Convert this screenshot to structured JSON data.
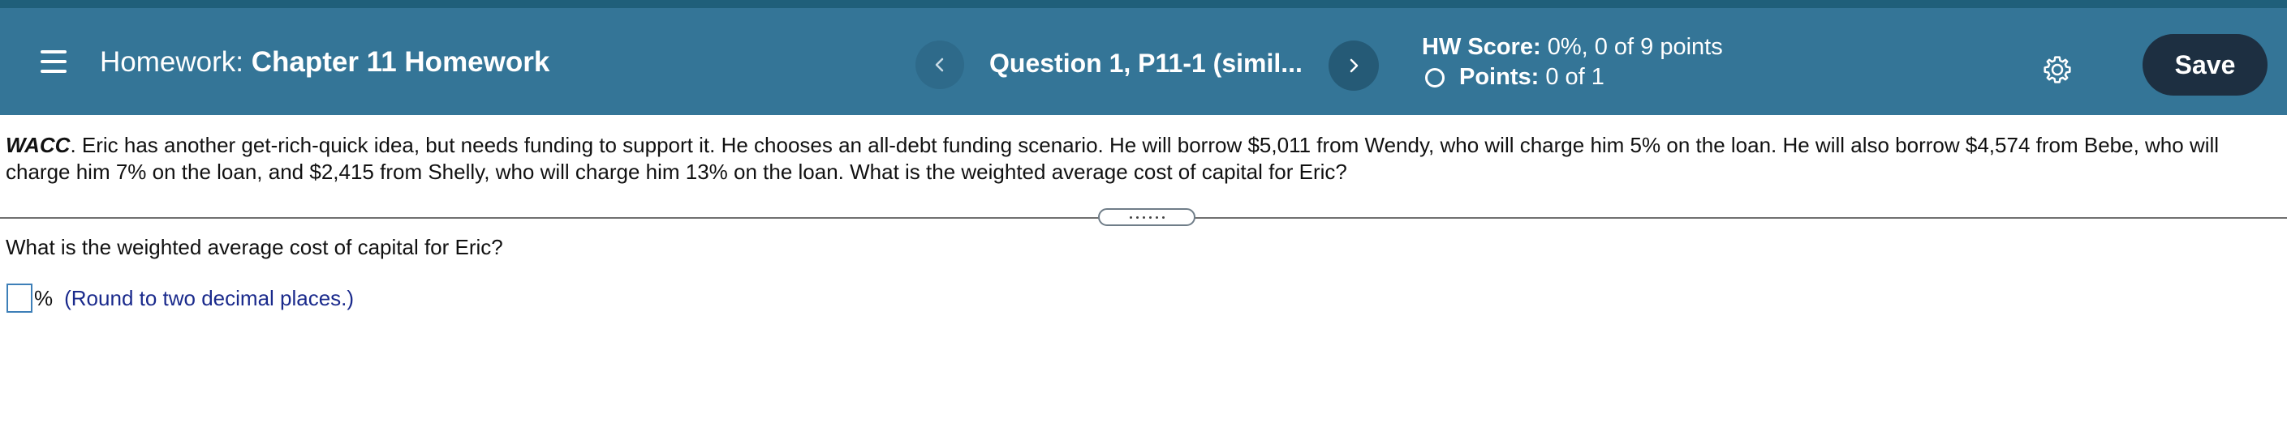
{
  "header": {
    "title_prefix": "Homework:",
    "title_name": "Chapter 11 Homework",
    "question_label": "Question 1, P11-1 (simil...",
    "hw_score_label": "HW Score:",
    "hw_score_value": "0%, 0 of 9 points",
    "points_label": "Points:",
    "points_value": "0 of 1",
    "save_label": "Save",
    "nav_prev_glyph": "‹",
    "nav_next_glyph": "›"
  },
  "problem": {
    "lead": "WACC",
    "text": ".  Eric has another get-rich-quick idea, but needs funding to support it.  He chooses an all-debt funding scenario.  He will borrow $5,011 from Wendy, who will charge him 5% on the loan.  He will also borrow $4,574 from Bebe, who will charge him 7% on the loan, and $2,415 from Shelly, who will charge him 13% on the loan.  What is the weighted average cost of capital for Eric?"
  },
  "question": {
    "prompt": "What is the weighted average cost of capital for Eric?",
    "answer_value": "",
    "unit": "%",
    "hint": "(Round to two decimal places.)"
  },
  "icons": {
    "menu": "hamburger-menu-icon",
    "prev": "chevron-left-icon",
    "next": "chevron-right-icon",
    "status": "radio-circle-icon",
    "settings": "gear-icon"
  },
  "colors": {
    "header_bg": "#347597",
    "save_bg": "#1d2f41",
    "hint_text": "#1a2a8c"
  }
}
